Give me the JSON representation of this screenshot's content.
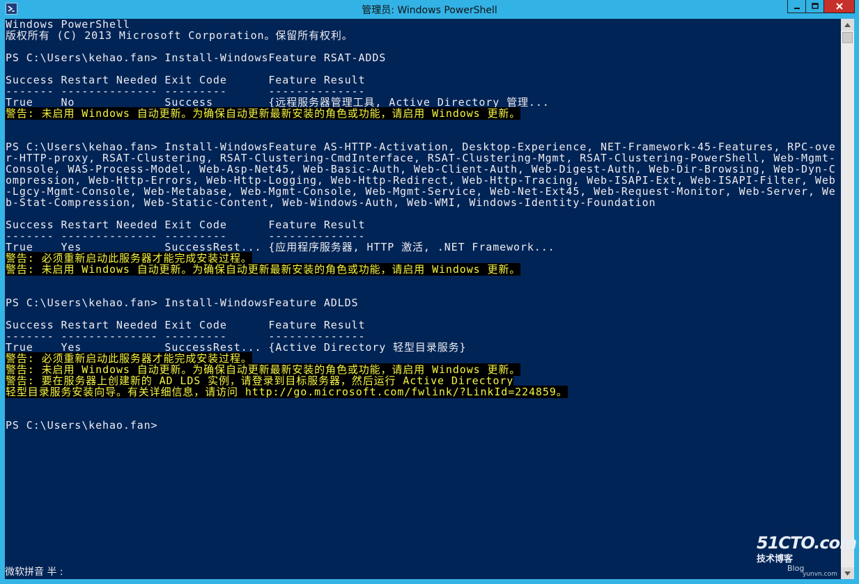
{
  "window": {
    "title": "管理员: Windows PowerShell",
    "minimize_glyph": "▁",
    "maximize_glyph": "□",
    "close_glyph": "✕"
  },
  "console": {
    "lines": [
      {
        "text": "Windows PowerShell",
        "warn": false
      },
      {
        "text": "版权所有 (C) 2013 Microsoft Corporation。保留所有权利。",
        "warn": false
      },
      {
        "text": "",
        "warn": false
      },
      {
        "text": "PS C:\\Users\\kehao.fan> Install-WindowsFeature RSAT-ADDS",
        "warn": false
      },
      {
        "text": "",
        "warn": false
      },
      {
        "text": "Success Restart Needed Exit Code      Feature Result",
        "warn": false
      },
      {
        "text": "------- -------------- ---------      --------------",
        "warn": false
      },
      {
        "text": "True    No             Success        {远程服务器管理工具, Active Directory 管理...",
        "warn": false
      },
      {
        "text": "警告: 未启用 Windows 自动更新。为确保自动更新最新安装的角色或功能，请启用 Windows 更新。",
        "warn": true
      },
      {
        "text": "",
        "warn": false
      },
      {
        "text": "",
        "warn": false
      },
      {
        "text": "PS C:\\Users\\kehao.fan> Install-WindowsFeature AS-HTTP-Activation, Desktop-Experience, NET-Framework-45-Features, RPC-ove",
        "warn": false
      },
      {
        "text": "r-HTTP-proxy, RSAT-Clustering, RSAT-Clustering-CmdInterface, RSAT-Clustering-Mgmt, RSAT-Clustering-PowerShell, Web-Mgmt-",
        "warn": false
      },
      {
        "text": "Console, WAS-Process-Model, Web-Asp-Net45, Web-Basic-Auth, Web-Client-Auth, Web-Digest-Auth, Web-Dir-Browsing, Web-Dyn-C",
        "warn": false
      },
      {
        "text": "ompression, Web-Http-Errors, Web-Http-Logging, Web-Http-Redirect, Web-Http-Tracing, Web-ISAPI-Ext, Web-ISAPI-Filter, Web",
        "warn": false
      },
      {
        "text": "-Lgcy-Mgmt-Console, Web-Metabase, Web-Mgmt-Console, Web-Mgmt-Service, Web-Net-Ext45, Web-Request-Monitor, Web-Server, We",
        "warn": false
      },
      {
        "text": "b-Stat-Compression, Web-Static-Content, Web-Windows-Auth, Web-WMI, Windows-Identity-Foundation",
        "warn": false
      },
      {
        "text": "",
        "warn": false
      },
      {
        "text": "Success Restart Needed Exit Code      Feature Result",
        "warn": false
      },
      {
        "text": "------- -------------- ---------      --------------",
        "warn": false
      },
      {
        "text": "True    Yes            SuccessRest... {应用程序服务器, HTTP 激活, .NET Framework...",
        "warn": false
      },
      {
        "text": "警告: 必须重新启动此服务器才能完成安装过程。",
        "warn": true
      },
      {
        "text": "警告: 未启用 Windows 自动更新。为确保自动更新最新安装的角色或功能，请启用 Windows 更新。",
        "warn": true
      },
      {
        "text": "",
        "warn": false
      },
      {
        "text": "",
        "warn": false
      },
      {
        "text": "PS C:\\Users\\kehao.fan> Install-WindowsFeature ADLDS",
        "warn": false
      },
      {
        "text": "",
        "warn": false
      },
      {
        "text": "Success Restart Needed Exit Code      Feature Result",
        "warn": false
      },
      {
        "text": "------- -------------- ---------      --------------",
        "warn": false
      },
      {
        "text": "True    Yes            SuccessRest... {Active Directory 轻型目录服务}",
        "warn": false
      },
      {
        "text": "警告: 必须重新启动此服务器才能完成安装过程。",
        "warn": true
      },
      {
        "text": "警告: 未启用 Windows 自动更新。为确保自动更新最新安装的角色或功能，请启用 Windows 更新。",
        "warn": true
      },
      {
        "text": "警告: 要在服务器上创建新的 AD LDS 实例，请登录到目标服务器，然后运行 Active Directory",
        "warn": true
      },
      {
        "text": "轻型目录服务安装向导。有关详细信息，请访问 http://go.microsoft.com/fwlink/?LinkId=224859。",
        "warn": true
      },
      {
        "text": "",
        "warn": false
      },
      {
        "text": "",
        "warn": false
      },
      {
        "text": "PS C:\\Users\\kehao.fan>",
        "warn": false
      }
    ]
  },
  "ime_status": "微软拼音 半 :",
  "watermark": {
    "logo": "51CTO.com",
    "subtitle": "技术博客",
    "blog": "Blog",
    "url": "yunvn.com"
  }
}
